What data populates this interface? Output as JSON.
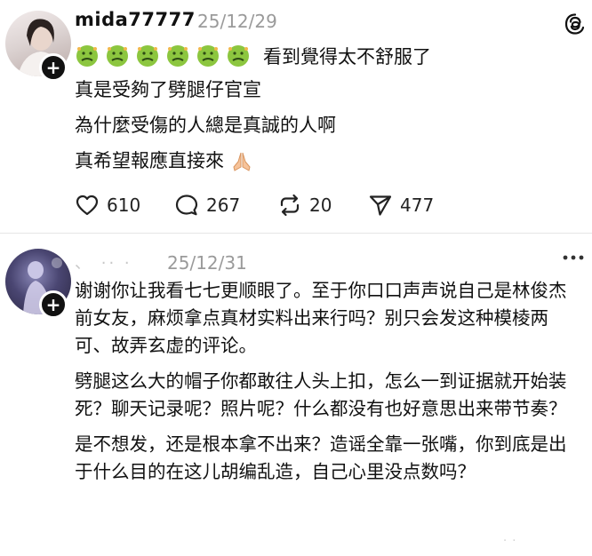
{
  "post1": {
    "username": "mida77777",
    "date": "25/12/29",
    "emoji_text": "看到覺得太不舒服了",
    "lines": [
      "真是受夠了劈腿仔官宣",
      "為什麼受傷的人總是真誠的人啊",
      "真希望報應直接來"
    ],
    "actions": {
      "likes": "610",
      "replies": "267",
      "reposts": "20",
      "shares": "477"
    }
  },
  "post2": {
    "masked_name": "、 ·· ·",
    "date": "25/12/31",
    "paragraphs": [
      "谢谢你让我看七七更顺眼了。至于你口口声声说自己是林俊杰前女友，麻烦拿点真材实料出来行吗？别只会发这种模棱两可、故弄玄虚的评论。",
      "劈腿这么大的帽子你都敢往人头上扣，怎么一到证据就开始装死？聊天记录呢？照片呢？什么都没有也好意思出来带节奏？",
      "是不想发，还是根本拿不出来？造谣全靠一张嘴，你到底是出于什么目的在这儿胡编乱造，自己心里没点数吗？"
    ]
  },
  "watermark": "· ·",
  "icons": {
    "emoji": "nauseated-face-emoji",
    "pray": "folded-hands-emoji",
    "like": "heart-icon",
    "reply": "speech-bubble-icon",
    "repost": "repost-icon",
    "share": "send-icon",
    "brand": "threads-logo",
    "more": "ellipsis-icon"
  },
  "colors": {
    "text": "#111111",
    "muted": "#9a9a9a",
    "emoji_green": "#8cc63f"
  }
}
